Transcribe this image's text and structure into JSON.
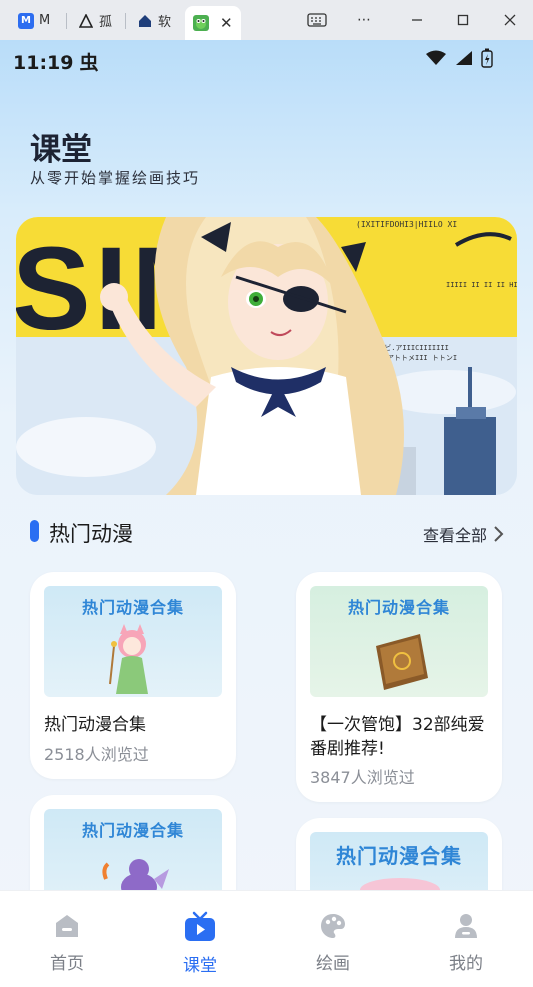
{
  "browser": {
    "tabs": [
      {
        "label": "M",
        "icon": "m-logo-icon"
      },
      {
        "label": "孤",
        "icon": "triangle-logo-icon"
      },
      {
        "label": "软",
        "icon": "house-logo-icon"
      },
      {
        "label": "",
        "icon": "green-frog-icon"
      }
    ]
  },
  "status": {
    "time": "11:19",
    "bug": "虫"
  },
  "header": {
    "title": "课堂",
    "subtitle": "从零开始掌握绘画技巧"
  },
  "banner": {
    "big_text": "SIMP",
    "small_text_1": "(IXITIFDOHI3|HIILO XI",
    "small_text_2": "IIIII II II II HIII",
    "small_text_3": "ヨロ.ビ.アIIICIIIIIII",
    "small_text_4": "ナぐメアトトメIII トトンI"
  },
  "section": {
    "title": "热门动漫",
    "see_all": "查看全部"
  },
  "cards": [
    {
      "thumb_title": "热门动漫合集",
      "title": "热门动漫合集",
      "count": "2518人浏览过"
    },
    {
      "thumb_title": "热门动漫合集",
      "title": "【一次管饱】32部纯爱番剧推荐!",
      "count": "3847人浏览过"
    },
    {
      "thumb_title": "热门动漫合集"
    },
    {
      "thumb_title": "热门动漫合集"
    }
  ],
  "nav": {
    "items": [
      {
        "label": "首页"
      },
      {
        "label": "课堂"
      },
      {
        "label": "绘画"
      },
      {
        "label": "我的"
      }
    ],
    "active_color": "#2a6ef2"
  }
}
